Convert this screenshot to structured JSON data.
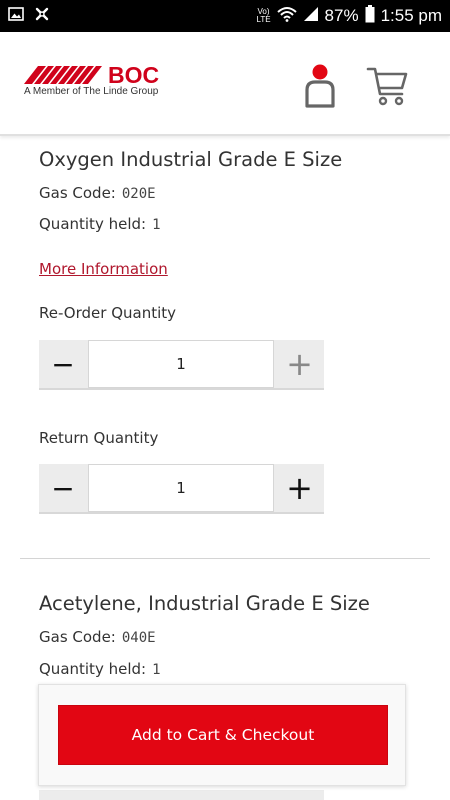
{
  "status_bar": {
    "volte_label": "Vo) LTE",
    "battery_percent": "87%",
    "time": "1:55 pm"
  },
  "header": {
    "brand_name": "BOC",
    "brand_subtitle": "A Member of The Linde Group",
    "brand_color": "#d0021b"
  },
  "products": [
    {
      "title": "Oxygen Industrial Grade E Size",
      "gas_code_label": "Gas Code:",
      "gas_code": "020E",
      "quantity_held_label": "Quantity held:",
      "quantity_held": "1",
      "more_info_label": "More Information",
      "reorder_label": "Re-Order Quantity",
      "reorder_value": "1",
      "return_label": "Return Quantity",
      "return_value": "1"
    },
    {
      "title": "Acetylene, Industrial Grade E Size",
      "gas_code_label": "Gas Code:",
      "gas_code": "040E",
      "quantity_held_label": "Quantity held:",
      "quantity_held": "1"
    }
  ],
  "stepper": {
    "minus_symbol": "−",
    "plus_symbol": "+"
  },
  "checkout": {
    "button_label": "Add to Cart & Checkout",
    "button_color": "#e20613"
  }
}
